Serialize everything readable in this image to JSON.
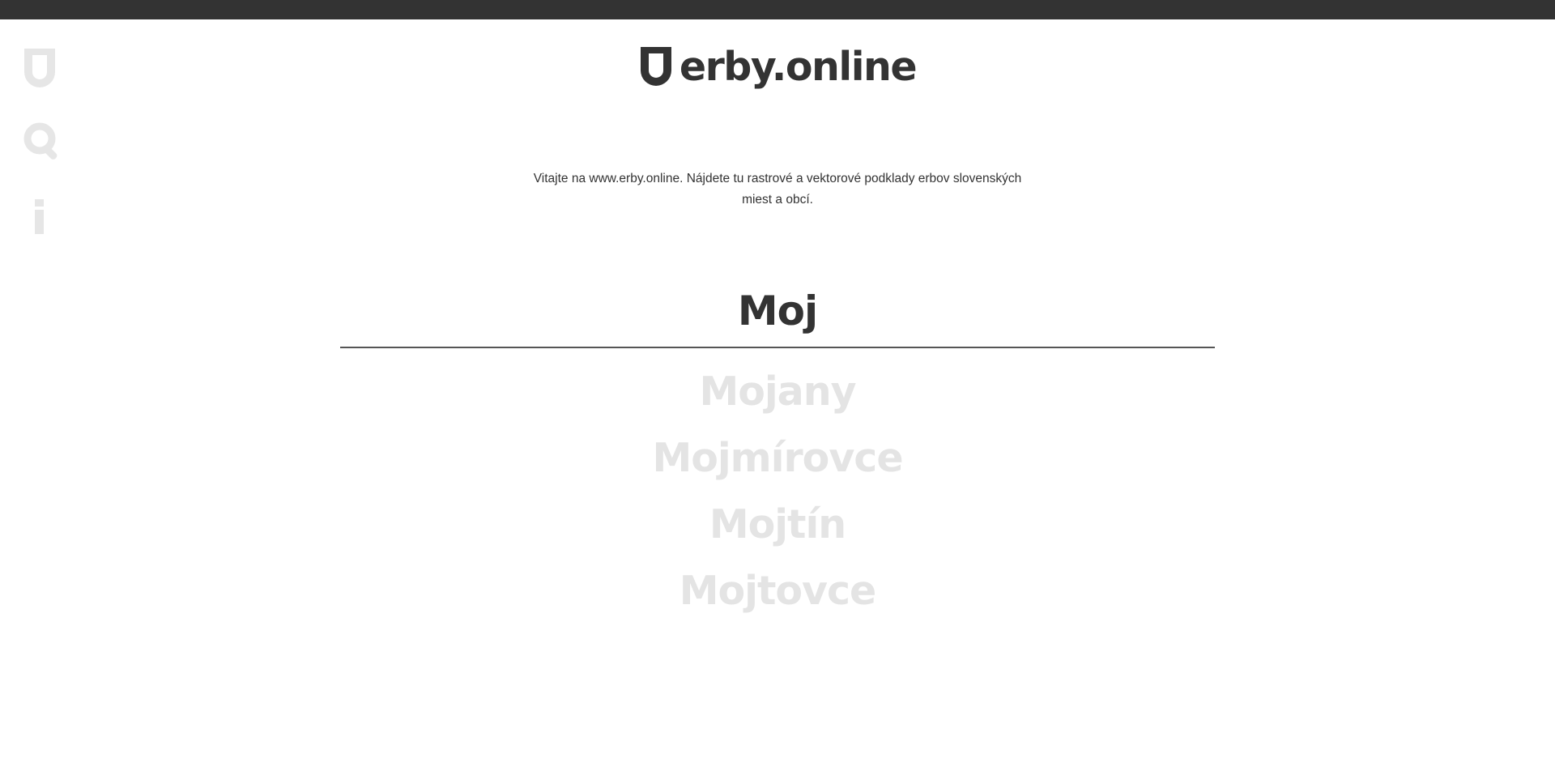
{
  "header": {
    "logo_text": "erby.online",
    "logo_icon": "shield-icon"
  },
  "sidenav": {
    "items": [
      {
        "icon": "shield-icon",
        "color": "#e6e6e6"
      },
      {
        "icon": "search-icon",
        "color": "#e6e6e6"
      },
      {
        "icon": "info-icon",
        "color": "#e6e6e6"
      }
    ]
  },
  "intro": {
    "text": "Vitajte na www.erby.online. Nájdete tu rastrové a vektorové podklady erbov slovenských miest a obcí."
  },
  "search": {
    "value": "Moj"
  },
  "results": [
    {
      "label": "Mojany"
    },
    {
      "label": "Mojmírovce"
    },
    {
      "label": "Mojtín"
    },
    {
      "label": "Mojtovce"
    }
  ],
  "colors": {
    "dark": "#333333",
    "muted": "#e4e4e4",
    "topbar": "#333333"
  }
}
